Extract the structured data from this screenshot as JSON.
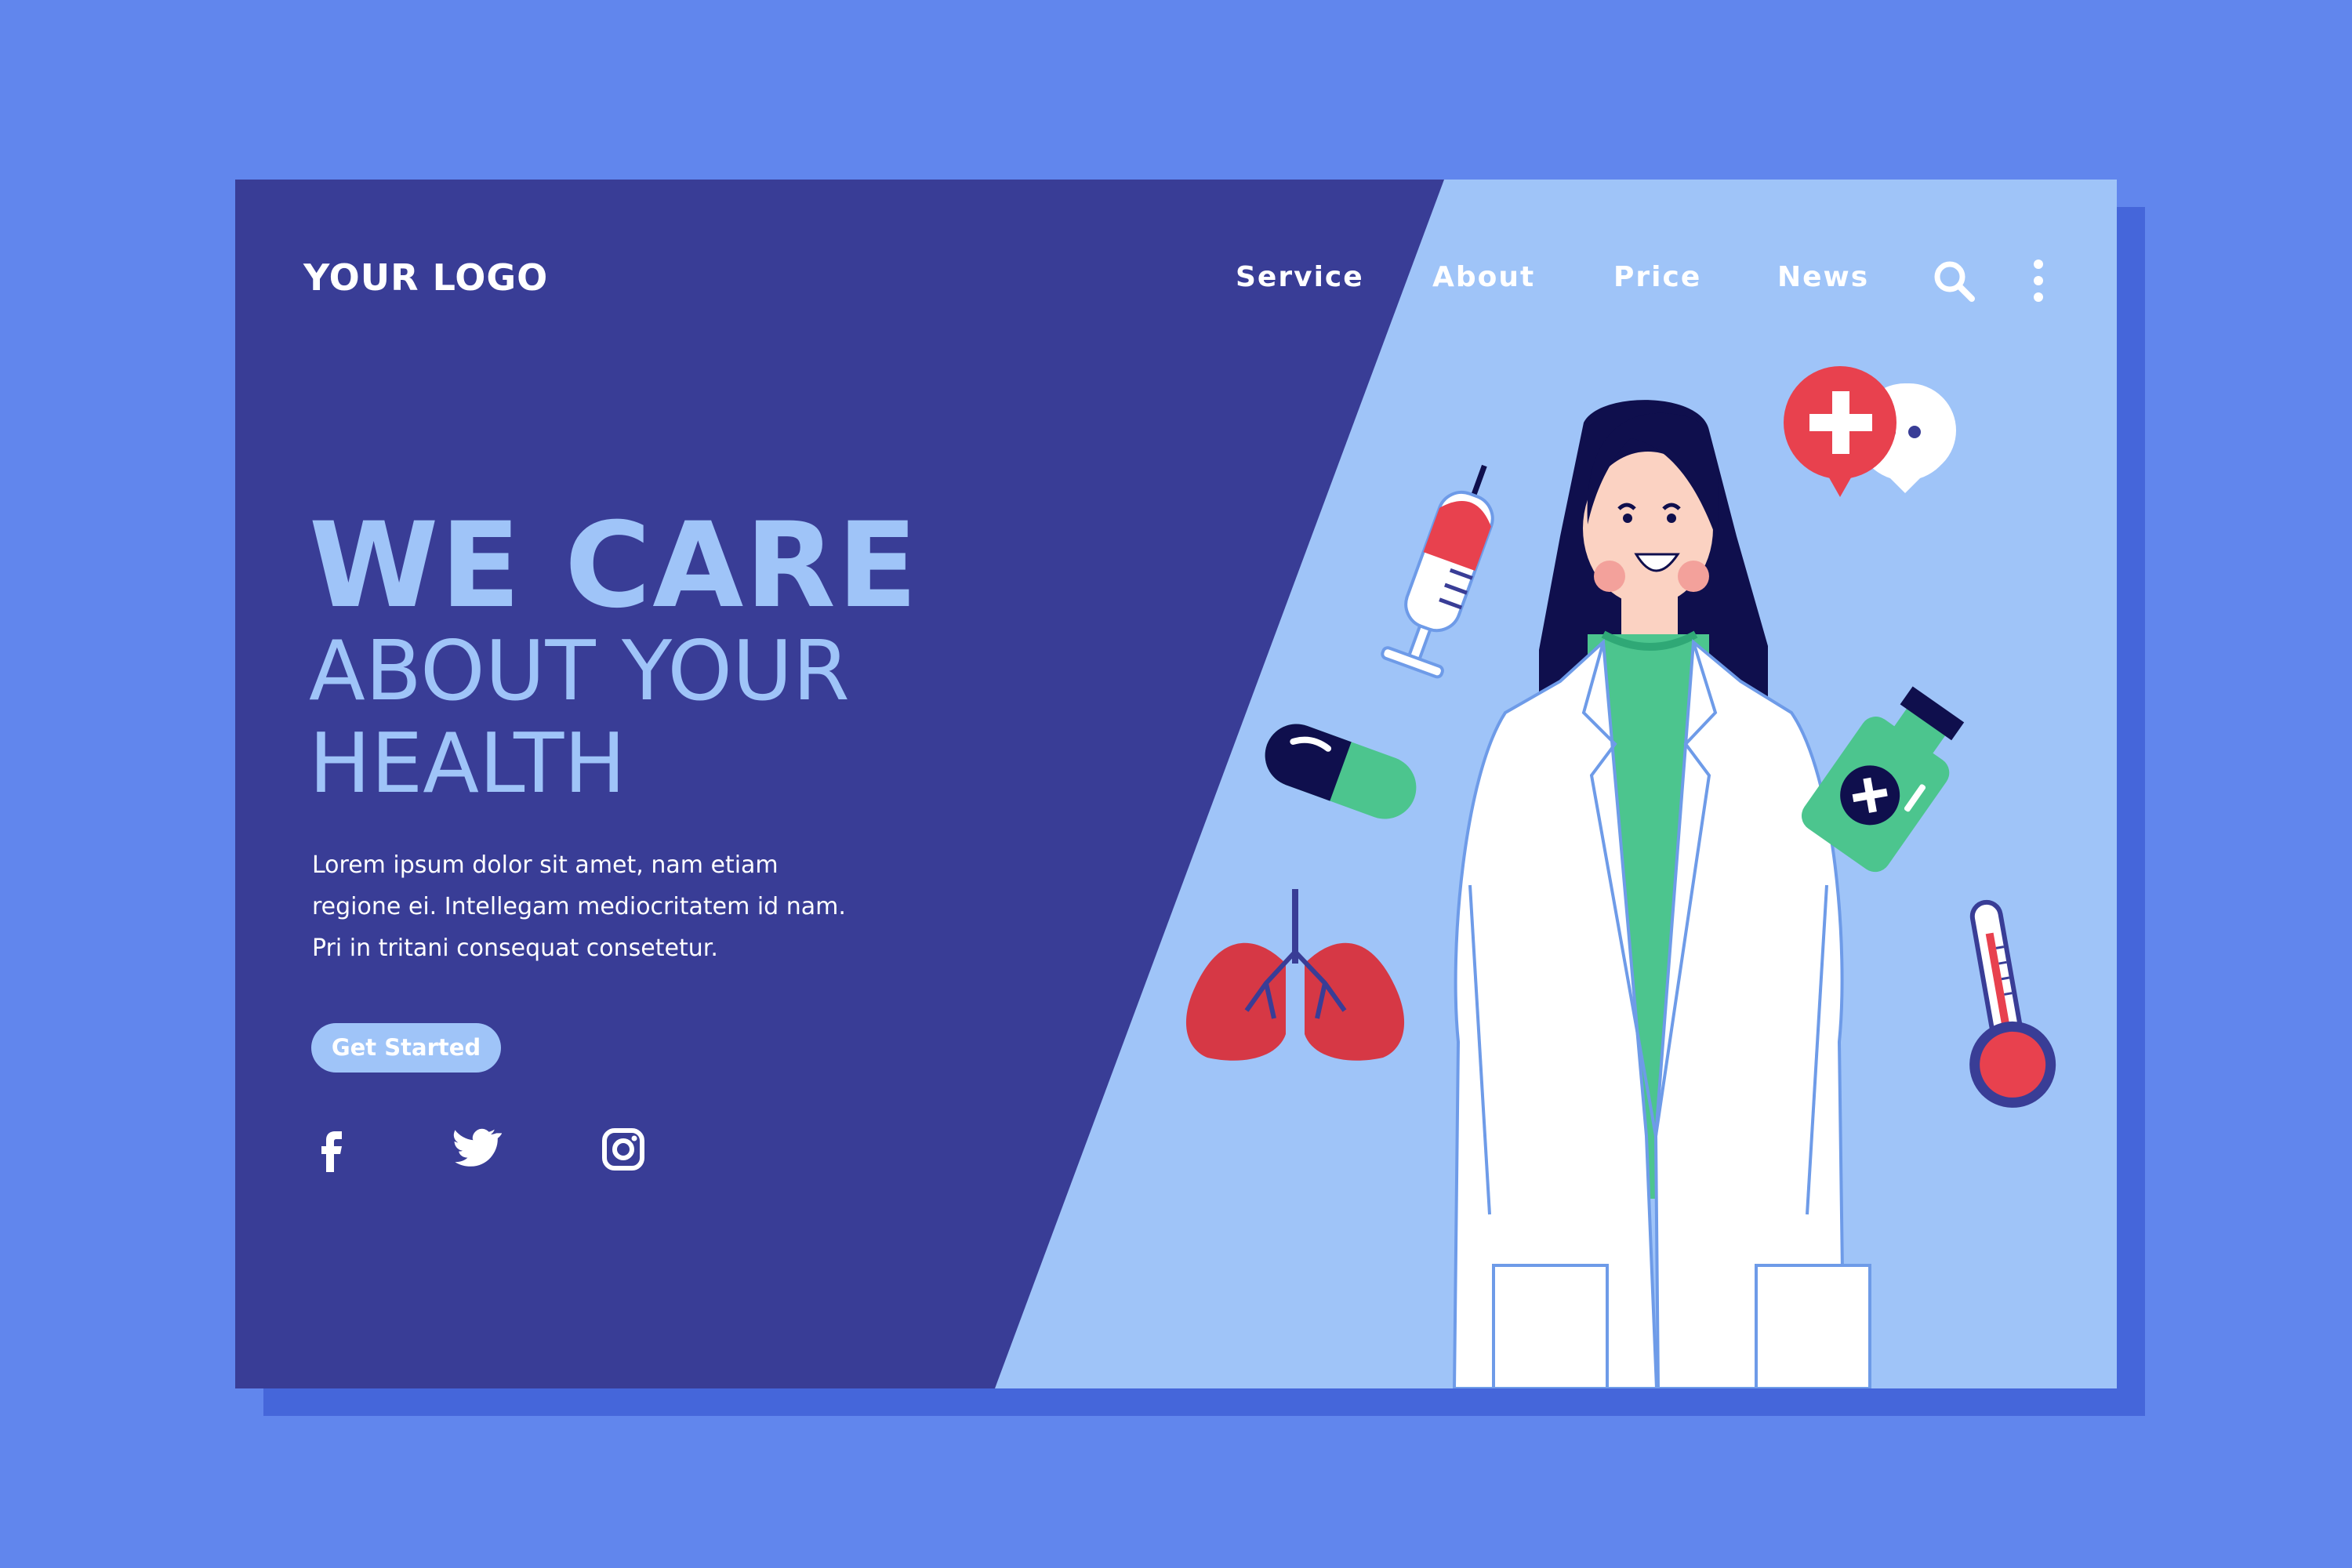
{
  "brand": {
    "logo_text": "YOUR LOGO"
  },
  "nav": {
    "items": [
      {
        "label": "Service"
      },
      {
        "label": "About"
      },
      {
        "label": "Price"
      },
      {
        "label": "News"
      }
    ],
    "search_icon": "search-icon",
    "more_icon": "more-vertical-icon"
  },
  "hero": {
    "heading_line1": "WE CARE",
    "heading_line2": "ABOUT YOUR",
    "heading_line3": "HEALTH",
    "description": [
      "Lorem ipsum dolor sit amet, nam etiam",
      "regione ei. Intellegam mediocritatem id nam.",
      "Pri in tritani consequat consetetur."
    ],
    "cta_label": "Get Started"
  },
  "social": {
    "icons": [
      "facebook-icon",
      "twitter-icon",
      "instagram-icon"
    ]
  },
  "colors": {
    "page_bg": "#6186ED",
    "card_shadow": "#4566DA",
    "panel_dark": "#393D96",
    "panel_light": "#9FC4F8",
    "accent_red": "#E8414E",
    "accent_green": "#4CC58E",
    "navy": "#0F0F4D"
  },
  "illustration": {
    "items": [
      "doctor",
      "syringe",
      "capsule",
      "lungs",
      "medical-cross-bubble",
      "chat-bubble",
      "medicine-bottle",
      "thermometer"
    ]
  }
}
